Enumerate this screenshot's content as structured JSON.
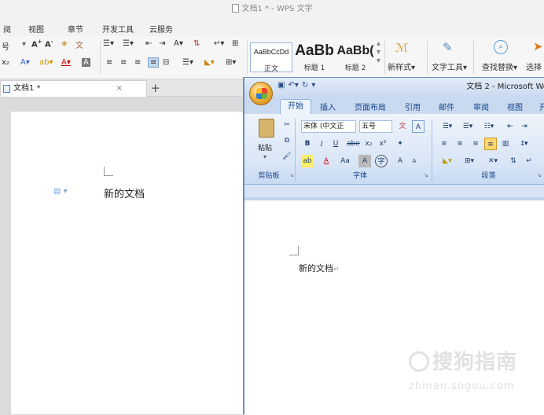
{
  "wps": {
    "title": "文档1 * - WPS 文字",
    "menu": [
      "阅",
      "视图",
      "章节",
      "开发工具",
      "云服务"
    ],
    "ribbon": {
      "font_size_value": "号",
      "styles": [
        {
          "sample": "AaBbCcDd",
          "name": "正文"
        },
        {
          "sample": "AaBb",
          "name": "标题 1"
        },
        {
          "sample": "AaBb(",
          "name": "标题 2"
        }
      ],
      "new_style": "新样式",
      "text_tools": "文字工具",
      "find_replace": "查找替换",
      "select": "选择"
    },
    "tab": {
      "label": "文档1 *",
      "close": "×",
      "new": "+"
    },
    "doc_text": "新的文档"
  },
  "word": {
    "title": "文档 2 - Microsoft Wor",
    "tabs": [
      "开始",
      "插入",
      "页面布局",
      "引用",
      "邮件",
      "审阅",
      "视图",
      "开"
    ],
    "ribbon": {
      "paste": "粘贴",
      "font_name": "宋体 (中文正",
      "font_size": "五号",
      "groups": [
        "剪贴板",
        "字体",
        "段落"
      ]
    },
    "doc_text": "新的文档"
  },
  "watermark": {
    "main": "搜狗指南",
    "sub": "zhinan.sogou.com"
  },
  "colors": {
    "word_accent": "#15428b",
    "wps_bg": "#f6f6f6"
  }
}
